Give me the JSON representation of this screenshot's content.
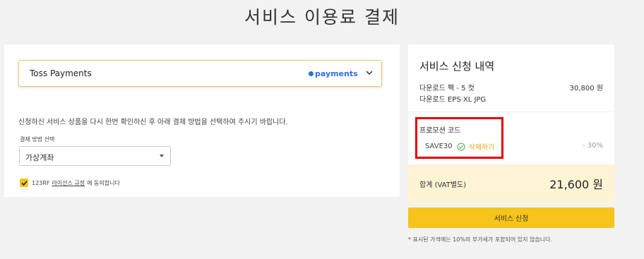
{
  "page": {
    "title": "서비스 이용료 결제"
  },
  "payment": {
    "provider": "Toss Payments",
    "provider_logo": "payments",
    "notice": "신청하신 서비스 상품을 다시 한번 확인하신 후 아래 결제 방법을 선택하여 주시기 바랍니다.",
    "method_label": "결제 방법 선택",
    "method_value": "가상계좌",
    "agree_prefix": "123RF",
    "agree_link": "라이선스 규정",
    "agree_suffix": "에 동의합니다",
    "agree_checked": true
  },
  "summary": {
    "title": "서비스 신청 내역",
    "item_name": "다운로드 팩 - 5 컷",
    "item_desc": "다운로드 EPS·XL JPG",
    "item_price": "30,800 원",
    "promo_label": "프로모션 코드",
    "promo_code": "SAVE30",
    "promo_delete": "삭제하기",
    "promo_discount": "- 30%",
    "total_label": "합계 (VAT별도)",
    "total_value": "21,600 원"
  },
  "submit_label": "서비스 신청",
  "footnote": "* 표시된 가격에는 10%의 부가세가 포함되어 있지 않습니다.",
  "colors": {
    "accent": "#f6c41a",
    "highlight": "#e50000",
    "link": "#e3a70f",
    "total_bg": "#fdf4d4"
  }
}
